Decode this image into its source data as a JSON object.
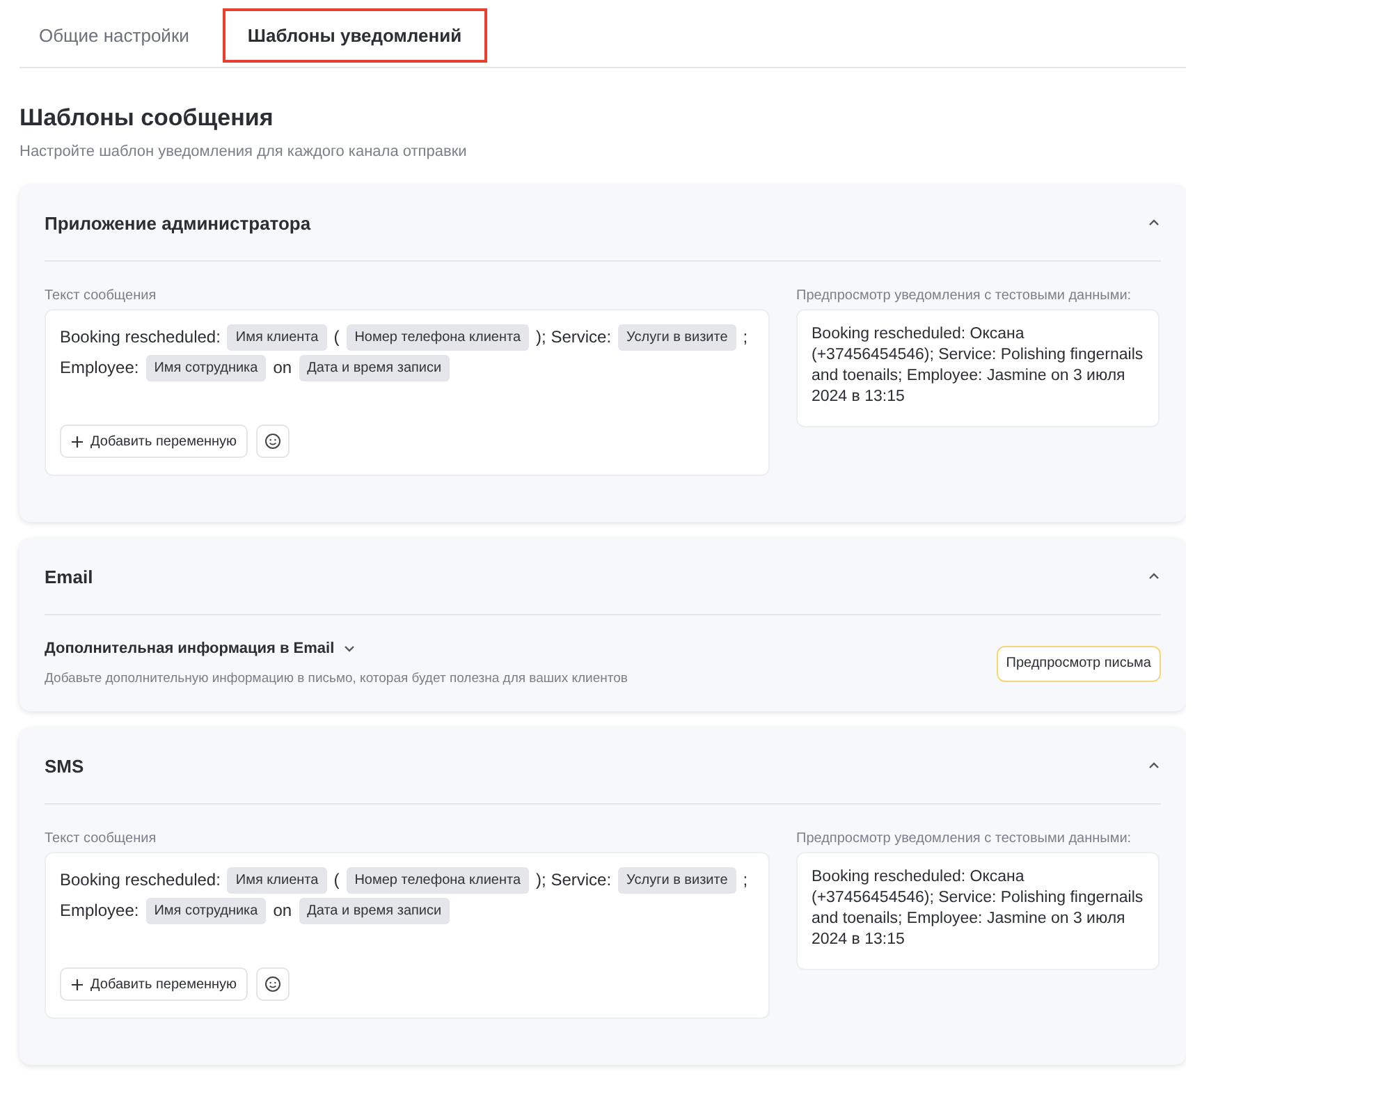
{
  "tabs": [
    {
      "label": "Общие настройки",
      "selected": false
    },
    {
      "label": "Шаблоны уведомлений",
      "selected": true
    }
  ],
  "heading": {
    "title": "Шаблоны сообщения",
    "subtitle": "Настройте шаблон уведомления для каждого канала отправки"
  },
  "sections": [
    {
      "kind": "template",
      "title": "Приложение администратора",
      "expanded": true,
      "editor_label": "Текст сообщения",
      "lines": [
        [
          {
            "kind": "text",
            "text": "Booking rescheduled:"
          },
          {
            "kind": "variable",
            "text": "Имя клиента"
          },
          {
            "kind": "text",
            "text": "("
          },
          {
            "kind": "variable",
            "text": "Номер телефона клиента"
          },
          {
            "kind": "text",
            "text": "); Service:"
          },
          {
            "kind": "variable",
            "text": "Услуги в визите"
          },
          {
            "kind": "text",
            "text": ";"
          }
        ],
        [
          {
            "kind": "text",
            "text": "Employee:"
          },
          {
            "kind": "variable",
            "text": "Имя сотрудника"
          },
          {
            "kind": "text",
            "text": "on"
          },
          {
            "kind": "variable",
            "text": "Дата и время записи"
          }
        ]
      ],
      "add_variable": "Добавить переменную",
      "preview_label": "Предпросмотр уведомления с тестовыми данными:",
      "preview": "Booking rescheduled: Оксана (+37456454546); Service: Polishing fingernails and toenails; Employee: Jasmine on 3 июля 2024 в 13:15"
    },
    {
      "kind": "email",
      "title": "Email",
      "expanded": true,
      "info_title": "Дополнительная информация в Email",
      "info_expanded": false,
      "info_text": "Добавьте дополнительную информацию в письмо, которая будет полезна для ваших клиентов",
      "preview_button": "Предпросмотр письма"
    },
    {
      "kind": "template",
      "title": "SMS",
      "expanded": true,
      "editor_label": "Текст сообщения",
      "lines": [
        [
          {
            "kind": "text",
            "text": "Booking rescheduled:"
          },
          {
            "kind": "variable",
            "text": "Имя клиента"
          },
          {
            "kind": "text",
            "text": "("
          },
          {
            "kind": "variable",
            "text": "Номер телефона клиента"
          },
          {
            "kind": "text",
            "text": "); Service:"
          },
          {
            "kind": "variable",
            "text": "Услуги в визите"
          },
          {
            "kind": "text",
            "text": ";"
          }
        ],
        [
          {
            "kind": "text",
            "text": "Employee:"
          },
          {
            "kind": "variable",
            "text": "Имя сотрудника"
          },
          {
            "kind": "text",
            "text": "on"
          },
          {
            "kind": "variable",
            "text": "Дата и время записи"
          }
        ]
      ],
      "add_variable": "Добавить переменную",
      "preview_label": "Предпросмотр уведомления с тестовыми данными:",
      "preview": "Booking rescheduled: Оксана (+37456454546); Service: Polishing fingernails and toenails; Employee: Jasmine on 3 июля 2024 в 13:15"
    }
  ]
}
